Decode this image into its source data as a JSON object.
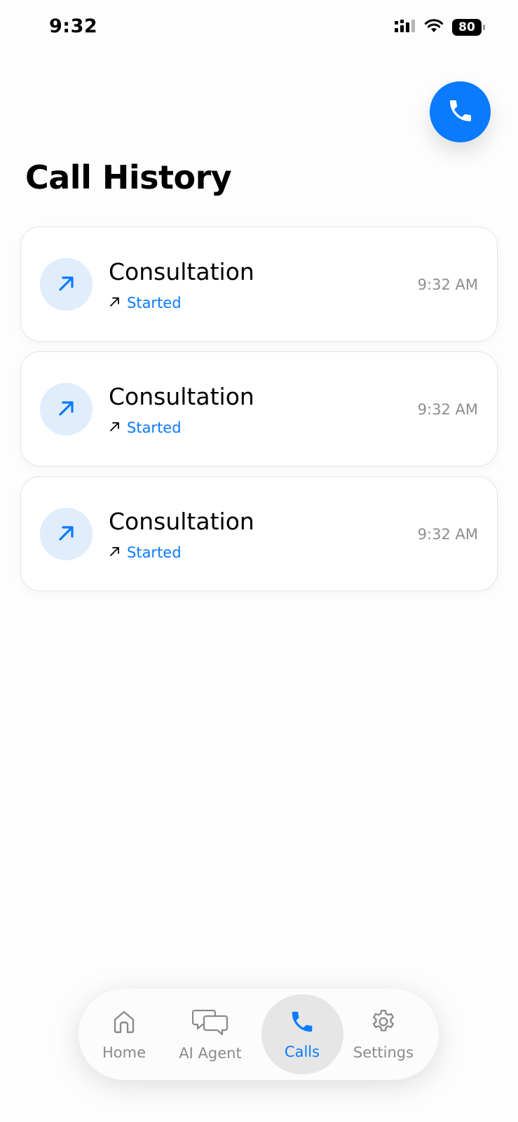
{
  "status_bar": {
    "time": "9:32",
    "battery": "80",
    "icons": [
      "signal-icon",
      "wifi-icon",
      "battery-icon"
    ]
  },
  "fab": {
    "icon": "phone-icon",
    "color": "#0A7AFF"
  },
  "page": {
    "title": "Call History"
  },
  "calls": [
    {
      "title": "Consultation",
      "status": "Started",
      "time": "9:32 AM",
      "direction_icon": "outgoing-arrow-icon"
    },
    {
      "title": "Consultation",
      "status": "Started",
      "time": "9:32 AM",
      "direction_icon": "outgoing-arrow-icon"
    },
    {
      "title": "Consultation",
      "status": "Started",
      "time": "9:32 AM",
      "direction_icon": "outgoing-arrow-icon"
    }
  ],
  "tab_bar": {
    "tabs": [
      {
        "label": "Home",
        "icon": "home-icon",
        "active": false
      },
      {
        "label": "AI Agent",
        "icon": "chat-bubbles-icon",
        "active": false
      },
      {
        "label": "Calls",
        "icon": "phone-icon",
        "active": true
      },
      {
        "label": "Settings",
        "icon": "gear-icon",
        "active": false
      }
    ]
  },
  "colors": {
    "accent": "#0A7AFF",
    "avatar_bg": "#DFEDFD",
    "muted_text": "#8E8E93"
  }
}
